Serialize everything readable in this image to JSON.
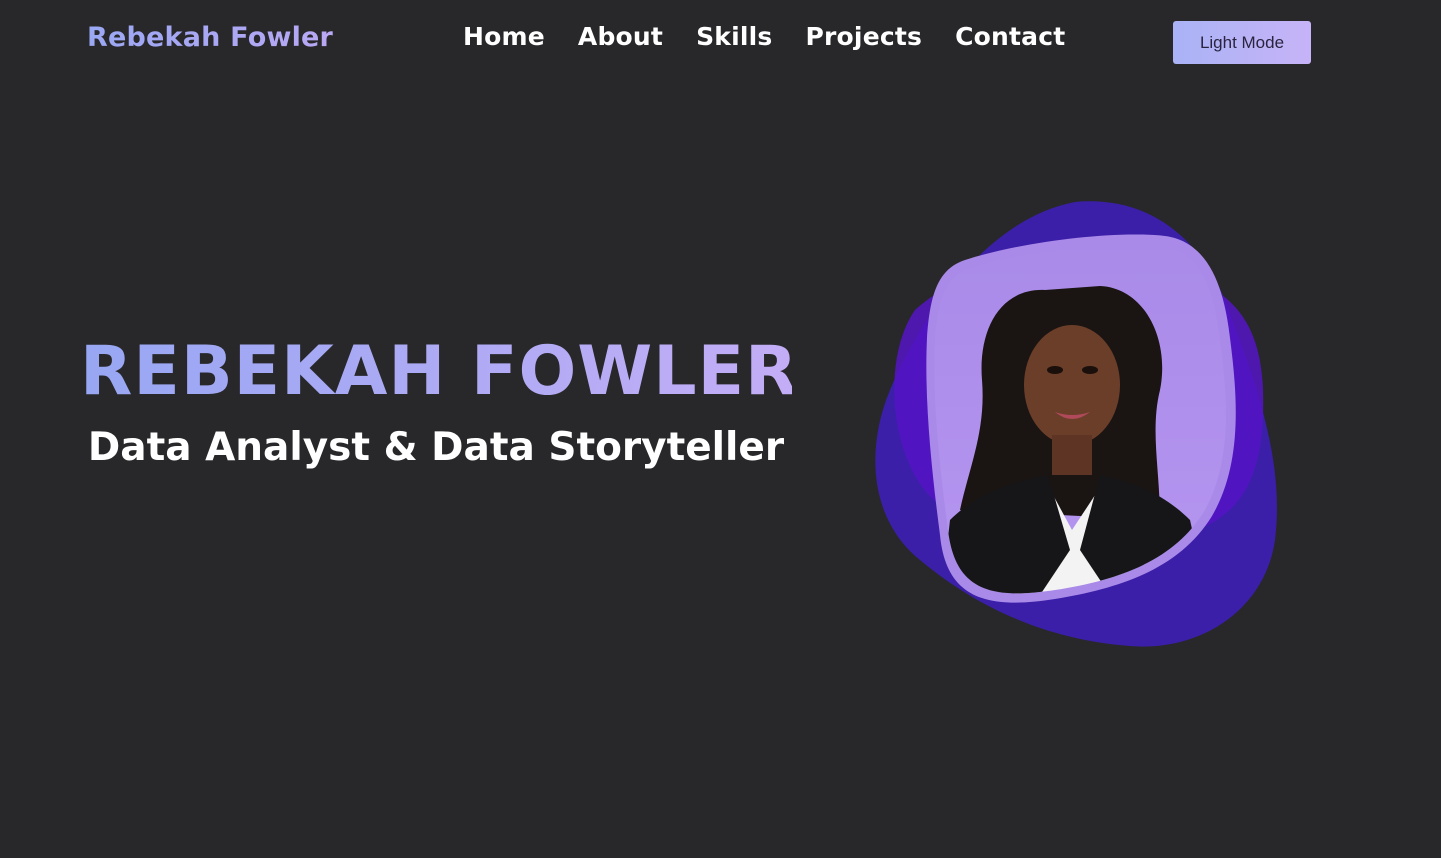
{
  "header": {
    "brand": "Rebekah Fowler",
    "nav": [
      {
        "label": "Home"
      },
      {
        "label": "About"
      },
      {
        "label": "Skills"
      },
      {
        "label": "Projects"
      },
      {
        "label": "Contact"
      }
    ],
    "mode_button": "Light Mode"
  },
  "hero": {
    "name": "REBEKAH FOWLER",
    "subtitle": "Data Analyst & Data Storyteller"
  },
  "colors": {
    "background": "#28282b",
    "accent_blob_dark": "#3b1fa8",
    "accent_blob_mid": "#5514c6",
    "frame_fill": "#a98ae8",
    "gradient_start": "#98a7f3",
    "gradient_end": "#c3adf6"
  }
}
